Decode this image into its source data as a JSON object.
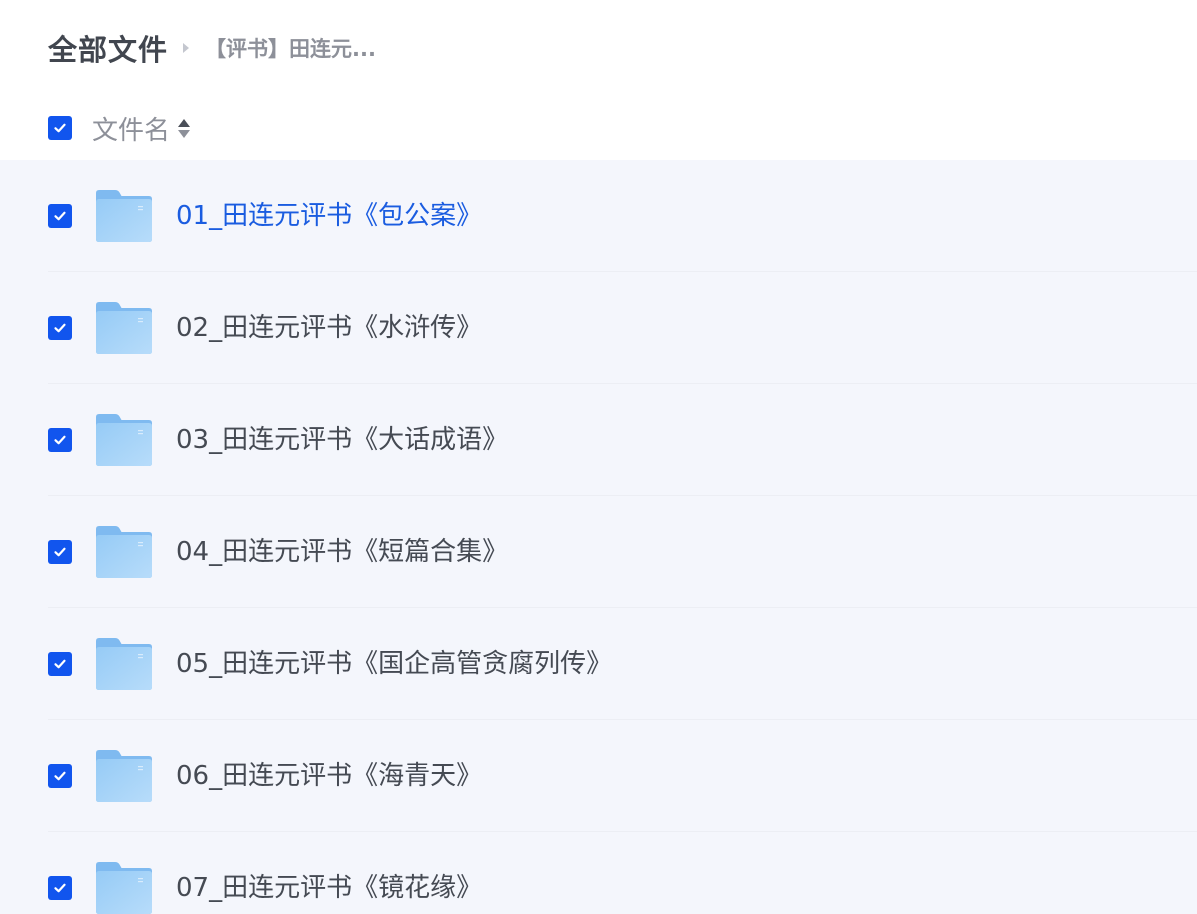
{
  "breadcrumb": {
    "root": "全部文件",
    "current": "【评书】田连元..."
  },
  "column_header": {
    "name_label": "文件名",
    "select_all_checked": true
  },
  "colors": {
    "accent": "#1155ee",
    "link_active": "#1a5ce0",
    "list_background": "#f4f6fc",
    "folder_icon": "#8ec6f5"
  },
  "files": [
    {
      "name": "01_田连元评书《包公案》",
      "type": "folder",
      "checked": true,
      "active": true
    },
    {
      "name": "02_田连元评书《水浒传》",
      "type": "folder",
      "checked": true
    },
    {
      "name": "03_田连元评书《大话成语》",
      "type": "folder",
      "checked": true
    },
    {
      "name": "04_田连元评书《短篇合集》",
      "type": "folder",
      "checked": true
    },
    {
      "name": "05_田连元评书《国企高管贪腐列传》",
      "type": "folder",
      "checked": true
    },
    {
      "name": "06_田连元评书《海青天》",
      "type": "folder",
      "checked": true
    },
    {
      "name": "07_田连元评书《镜花缘》",
      "type": "folder",
      "checked": true
    }
  ],
  "icons": {
    "checkbox": "checkmark-icon",
    "folder": "folder-icon",
    "sort": "sort-icon",
    "separator": "chevron-right-icon"
  }
}
